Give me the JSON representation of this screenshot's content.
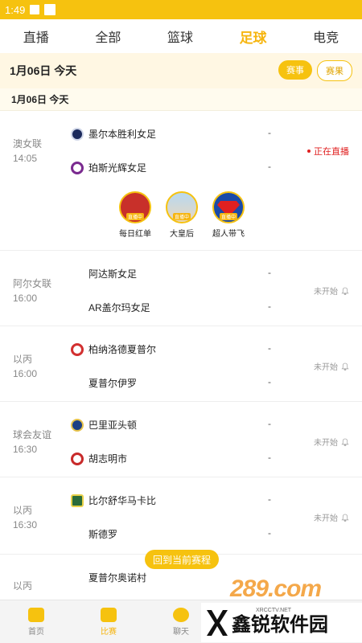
{
  "status_bar": {
    "time": "1:49"
  },
  "tabs": [
    "直播",
    "全部",
    "篮球",
    "足球",
    "电竞"
  ],
  "active_tab": "足球",
  "header": {
    "date": "1月06日  今天",
    "btn_events": "赛事",
    "btn_results": "赛果"
  },
  "date_row": "1月06日  今天",
  "matches": [
    {
      "league": "澳女联",
      "time": "14:05",
      "home": "墨尔本胜利女足",
      "away": "珀斯光辉女足",
      "home_score": "-",
      "away_score": "-",
      "status": "正在直播"
    },
    {
      "league": "阿尔女联",
      "time": "16:00",
      "home": "阿达斯女足",
      "away": "AR盖尔玛女足",
      "home_score": "-",
      "away_score": "-",
      "status": "未开始"
    },
    {
      "league": "以丙",
      "time": "16:00",
      "home": "柏纳洛德夏普尔",
      "away": "夏普尔伊罗",
      "home_score": "-",
      "away_score": "-",
      "status": "未开始"
    },
    {
      "league": "球会友谊",
      "time": "16:30",
      "home": "巴里亚头顿",
      "away": "胡志明市",
      "home_score": "-",
      "away_score": "-",
      "status": "未开始"
    },
    {
      "league": "以丙",
      "time": "16:30",
      "home": "比尔舒华马卡比",
      "away": "斯德罗",
      "home_score": "-",
      "away_score": "-",
      "status": "未开始"
    },
    {
      "league": "以丙",
      "time": "",
      "home": "夏普尔奥诺村",
      "away": "",
      "home_score": "",
      "away_score": "",
      "status": ""
    }
  ],
  "streamers": [
    {
      "name": "每日红单",
      "tag": "直播中"
    },
    {
      "name": "大皇后",
      "tag": "直播中"
    },
    {
      "name": "超人带飞",
      "tag": "直播中"
    }
  ],
  "back_button": "回到当前赛程",
  "bottom_nav": [
    "首页",
    "比赛",
    "聊天"
  ],
  "watermark": {
    "top": "289.com",
    "name": "鑫锐软件园",
    "url": "XRCCTV.NET"
  },
  "colors": {
    "accent": "#f6c20f",
    "live": "#e02020"
  }
}
